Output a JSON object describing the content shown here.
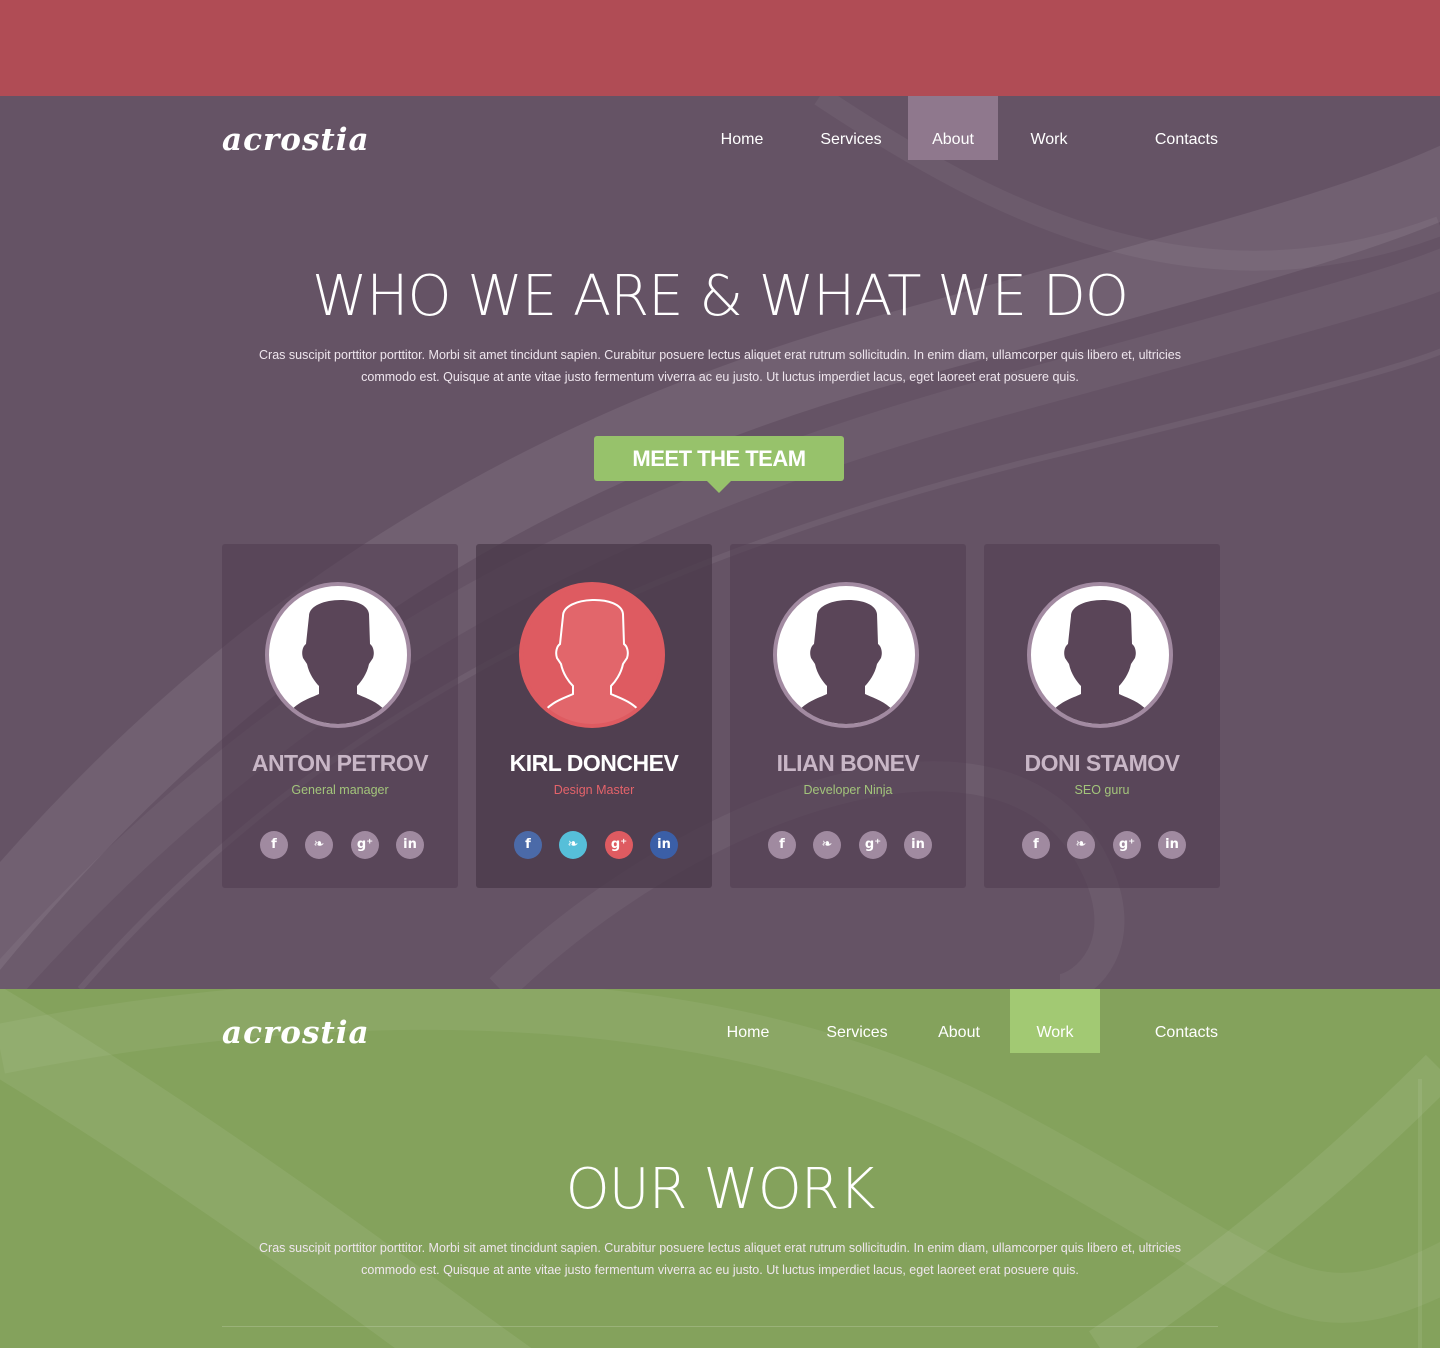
{
  "brand": {
    "logo": "acrostia"
  },
  "nav": {
    "items": [
      {
        "label": "Home"
      },
      {
        "label": "Services"
      },
      {
        "label": "About"
      },
      {
        "label": "Work"
      },
      {
        "label": "Contacts"
      }
    ]
  },
  "about": {
    "title": "WHO WE ARE & WHAT WE DO",
    "text": "Cras suscipit porttitor porttitor. Morbi sit amet tincidunt sapien. Curabitur posuere lectus aliquet erat rutrum sollicitudin. In enim diam, ullamcorper quis libero et, ultricies commodo est. Quisque at ante vitae justo fermentum viverra ac eu justo. Ut luctus imperdiet lacus, eget laoreet erat posuere quis.",
    "active_nav": "About",
    "meet_button": "MEET THE TEAM",
    "team": [
      {
        "name": "ANTON PETROV",
        "role": "General manager"
      },
      {
        "name": "KIRL DONCHEV",
        "role": "Design Master",
        "featured": true
      },
      {
        "name": "ILIAN BONEV",
        "role": "Developer Ninja"
      },
      {
        "name": "DONI STAMOV",
        "role": "SEO guru"
      }
    ],
    "social_icons": [
      "facebook-icon",
      "twitter-icon",
      "google-plus-icon",
      "linkedin-icon"
    ],
    "social_glyphs": {
      "facebook": "f",
      "twitter": "❧",
      "google_plus": "g⁺",
      "linkedin": "in"
    }
  },
  "work": {
    "title": "OUR WORK",
    "text": "Cras suscipit porttitor porttitor. Morbi sit amet tincidunt sapien. Curabitur posuere lectus aliquet erat rutrum sollicitudin. In enim diam, ullamcorper quis libero et, ultricies commodo est. Quisque at ante vitae justo fermentum viverra ac eu justo. Ut luctus imperdiet lacus, eget laoreet erat posuere quis.",
    "active_nav": "Work"
  },
  "colors": {
    "top_band": "#b04c55",
    "about_bg": "#655365",
    "about_active_nav": "#8f788d",
    "work_bg": "#84a25c",
    "work_active_nav": "#a2c973",
    "accent_green": "#97c26b",
    "accent_red": "#de5b61"
  }
}
